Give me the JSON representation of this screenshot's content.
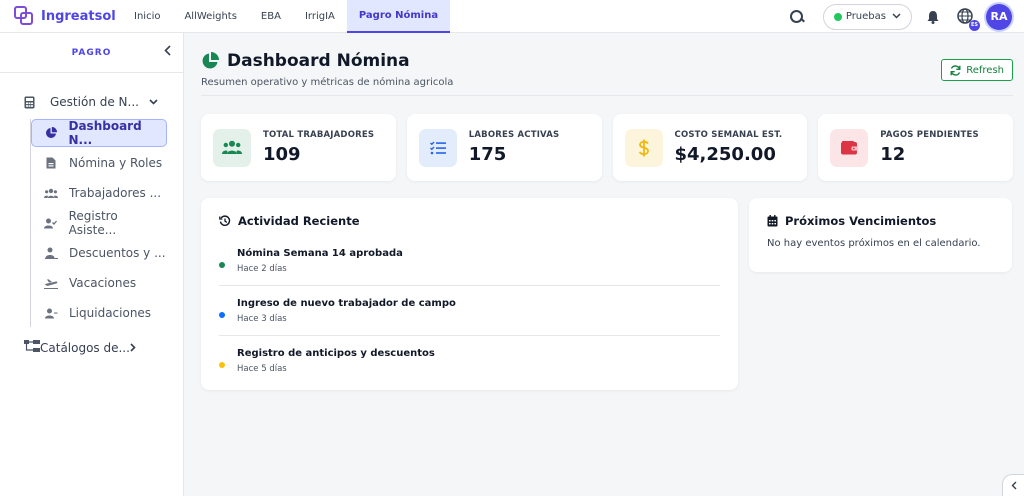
{
  "brand": {
    "name": "Ingreatsol"
  },
  "nav": {
    "tabs": [
      {
        "label": "Inicio"
      },
      {
        "label": "AllWeights"
      },
      {
        "label": "EBA"
      },
      {
        "label": "IrrigIA"
      },
      {
        "label": "Pagro Nómina",
        "active": true
      }
    ]
  },
  "topbar": {
    "environment": "Pruebas",
    "language_badge": "ES",
    "avatar_initials": "RA"
  },
  "sidebar": {
    "title": "PAGRO",
    "group": {
      "label": "Gestión de N...",
      "icon": "calculator-icon",
      "expanded": true
    },
    "items": [
      {
        "label": "Dashboard N...",
        "icon": "chart-pie-icon",
        "active": true
      },
      {
        "label": "Nómina y Roles",
        "icon": "file-invoice-icon"
      },
      {
        "label": "Trabajadores ...",
        "icon": "users-icon"
      },
      {
        "label": "Registro Asiste...",
        "icon": "user-check-icon"
      },
      {
        "label": "Descuentos y ...",
        "icon": "user-minus-icon"
      },
      {
        "label": "Vacaciones",
        "icon": "plane-icon"
      },
      {
        "label": "Liquidaciones",
        "icon": "user-clock-icon"
      }
    ],
    "group2": {
      "label": "Catálogos de...",
      "icon": "sitemap-icon",
      "expanded": false
    }
  },
  "page": {
    "title": "Dashboard Nómina",
    "subtitle": "Resumen operativo y métricas de nómina agricola",
    "refresh_label": "Refresh"
  },
  "kpis": [
    {
      "label": "TOTAL TRABAJADORES",
      "value": "109",
      "icon": "users-icon",
      "color": "#198754",
      "bg": "#e3f1ea"
    },
    {
      "label": "LABORES ACTIVAS",
      "value": "175",
      "icon": "list-check-icon",
      "color": "#2563eb",
      "bg": "#e3ecfb"
    },
    {
      "label": "COSTO SEMANAL EST.",
      "value": "$4,250.00",
      "icon": "dollar-icon",
      "color": "#f2b80f",
      "bg": "#fdf4dc"
    },
    {
      "label": "PAGOS PENDIENTES",
      "value": "12",
      "icon": "wallet-icon",
      "color": "#dc3545",
      "bg": "#fbe5e7"
    }
  ],
  "activity": {
    "title": "Actividad Reciente",
    "items": [
      {
        "title": "Nómina Semana 14 aprobada",
        "time": "Hace 2 días",
        "color": "#198754"
      },
      {
        "title": "Ingreso de nuevo trabajador de campo",
        "time": "Hace 3 días",
        "color": "#0d6efd"
      },
      {
        "title": "Registro de anticipos y descuentos",
        "time": "Hace 5 días",
        "color": "#ffc107"
      }
    ]
  },
  "upcoming": {
    "title": "Próximos Vencimientos",
    "empty_text": "No hay eventos próximos en el calendario."
  }
}
